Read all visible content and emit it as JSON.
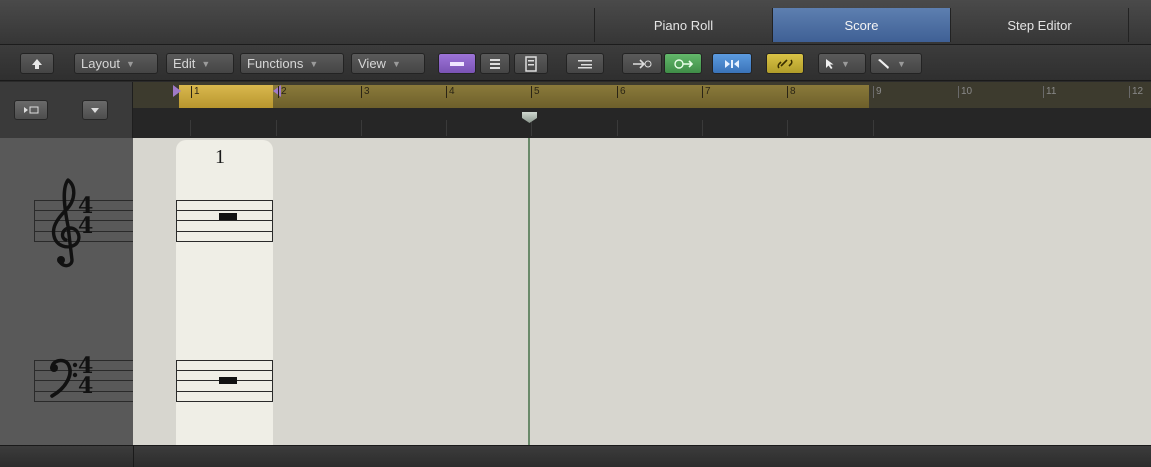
{
  "tabs": [
    {
      "label": "Piano Roll",
      "active": false
    },
    {
      "label": "Score",
      "active": true
    },
    {
      "label": "Step Editor",
      "active": false
    }
  ],
  "toolbar": {
    "back_icon": "up-arrow-icon",
    "menus": [
      {
        "label": "Layout"
      },
      {
        "label": "Edit"
      },
      {
        "label": "Functions"
      },
      {
        "label": "View"
      }
    ],
    "view_buttons": [
      "linear-view-icon",
      "page-view-icon",
      "score-sets-icon"
    ],
    "mode_buttons": [
      "midi-in-icon",
      "catch-icon",
      "midi-out-icon",
      "flex-icon",
      "link-icon"
    ],
    "tools": [
      "pointer-tool-icon",
      "pencil-tool-icon"
    ],
    "accent_colors": {
      "purple": "#8a62c4",
      "green": "#4fa259",
      "blue": "#4a86cc",
      "yellow": "#c8b137",
      "selected_tab": "#4f70a3"
    }
  },
  "ruler": {
    "bars": [
      "1",
      "2",
      "3",
      "4",
      "5",
      "6",
      "7",
      "8",
      "9",
      "10",
      "11",
      "12"
    ]
  },
  "score": {
    "measure_number": "1",
    "clefs": [
      "treble",
      "bass"
    ],
    "time_signature": {
      "top": "4",
      "bottom": "4"
    }
  }
}
